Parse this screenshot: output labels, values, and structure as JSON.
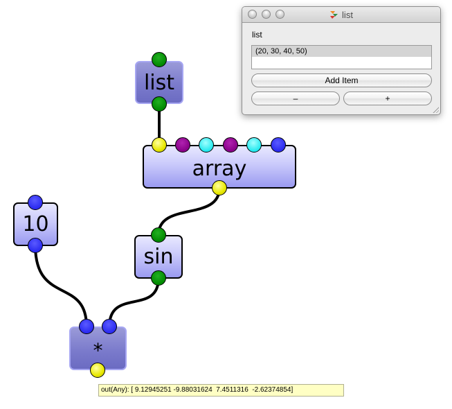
{
  "graph": {
    "nodes": {
      "list": "list",
      "array": "array",
      "ten": "10",
      "sin": "sin",
      "multiply": "*"
    },
    "tooltip": "out(Any): [ 9.12945251 -9.88031624  7.4511316  -2.62374854]"
  },
  "window": {
    "title": "list",
    "label": "list",
    "items": [
      "(20, 30, 40, 50)"
    ],
    "add_button": "Add Item",
    "minus_button": "–",
    "plus_button": "+"
  },
  "colors": {
    "node_fill": "#c9c9fb",
    "wire": "#000000",
    "port_green": "#008800",
    "port_yellow": "#e8e800",
    "port_purple": "#880088",
    "port_cyan": "#22e8ee",
    "port_blue": "#2a2af0",
    "tooltip_bg": "#ffffc4"
  }
}
